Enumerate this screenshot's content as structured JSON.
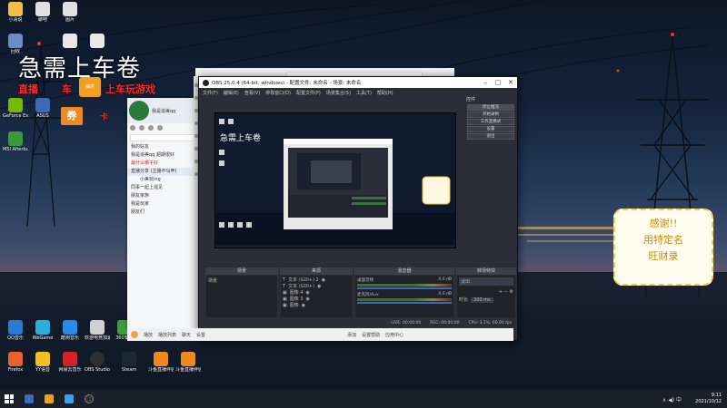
{
  "desktop": {
    "top_icons": [
      {
        "label": "小清说",
        "color": "#f0c040"
      },
      {
        "label": "聊吧",
        "color": "#e0e0e0"
      },
      {
        "label": "图片",
        "color": "#e0e0e0"
      }
    ],
    "mid_icons": [
      {
        "label": "回收",
        "color": "#6a8ac8"
      },
      {
        "label": "",
        "color": "#e8e8e8"
      },
      {
        "label": "",
        "color": "#e8e8e8"
      }
    ],
    "left_icons": [
      {
        "label": "GeForce Experience",
        "color": "#76b900"
      },
      {
        "label": "ASUS",
        "color": "#3a6ab8"
      },
      {
        "label": "MSI Afterburner",
        "color": "#3a9a3a"
      }
    ],
    "bottom_row1": [
      {
        "label": "QQ音乐",
        "color": "#2a7ad8"
      },
      {
        "label": "WeGame",
        "color": "#2ab0d8"
      },
      {
        "label": "酷狗音乐",
        "color": "#2a8ae8"
      },
      {
        "label": "欢游电竞加速器",
        "color": "#d0d0d0"
      },
      {
        "label": "360安全",
        "color": "#3aa03a"
      }
    ],
    "bottom_row2": [
      {
        "label": "Firefox",
        "color": "#e8602a"
      },
      {
        "label": "YY语音",
        "color": "#f0c020"
      },
      {
        "label": "网易云音乐",
        "color": "#d8202a"
      },
      {
        "label": "OBS Studio",
        "color": "#303030"
      },
      {
        "label": "Steam",
        "color": "#1b2838"
      },
      {
        "label": "斗鱼直播伴侣",
        "color": "#f08820"
      },
      {
        "label": "斗鱼直播伴侣",
        "color": "#f08820"
      }
    ]
  },
  "overlays": {
    "title": "急需上车卷",
    "red_left": "直播",
    "red_mid": "车",
    "badge": "抽奖",
    "red_right": "上车玩游戏",
    "coupon": "券",
    "coupon_tail": "卡"
  },
  "qq": {
    "name": "我是追美qq",
    "items": [
      {
        "label": "我的好友",
        "style": ""
      },
      {
        "label": "我是追美qq 超期很好",
        "style": ""
      },
      {
        "label": "最什么哪子好",
        "style": "red"
      },
      {
        "label": "直播分享 (主播不马甲)",
        "style": "sel"
      },
      {
        "label": "小美玩ing",
        "style": ""
      },
      {
        "label": "同事一起上混见",
        "style": ""
      },
      {
        "label": "朋友家族",
        "style": ""
      },
      {
        "label": "我是玩家",
        "style": ""
      },
      {
        "label": "朋友们",
        "style": ""
      }
    ]
  },
  "obs": {
    "title": "OBS 25.0.4 (64-bit, windows) - 配置文件: 未命名 - 场景: 未命名",
    "menu": [
      "文件(F)",
      "编辑(E)",
      "查看(V)",
      "停靠窗口(D)",
      "配置文件(P)",
      "场景集合(S)",
      "工具(T)",
      "帮助(H)"
    ],
    "controls_title": "控件",
    "control_buttons": [
      {
        "label": "停止推流",
        "active": true
      },
      {
        "label": "开始录制",
        "active": false
      },
      {
        "label": "工作室模式",
        "active": false
      },
      {
        "label": "设置",
        "active": false
      },
      {
        "label": "退出",
        "active": false
      }
    ],
    "scenes": {
      "header": "场景",
      "items": [
        "场景"
      ]
    },
    "sources": {
      "header": "来源",
      "items": [
        "文本 (GDI+) 2",
        "文本 (GDI+)",
        "图像 4",
        "图像 3",
        "图像"
      ]
    },
    "mixer": {
      "header": "混音器",
      "channels": [
        {
          "name": "桌面音频",
          "db": "0.0 dB"
        },
        {
          "name": "麦克风/Aux",
          "db": "0.0 dB"
        }
      ]
    },
    "transitions": {
      "header": "转场特效",
      "type": "淡出",
      "duration_label": "时长",
      "duration_value": "300 ms"
    },
    "status": [
      "LIVE: 00:00:00",
      "REC: 00:00:00",
      "CPU: 3.1%, 60.00 fps"
    ]
  },
  "qqbar": {
    "items": [
      "播放",
      "播放列表",
      "聊天",
      "设置",
      "添加",
      "设置帮助",
      "应用中心"
    ]
  },
  "sticker": {
    "line1": "感谢!!",
    "line2": "用特定名",
    "line3": "旺财录"
  },
  "taskbar": {
    "time": "9:11",
    "date": "2021/10/12",
    "ime": "中"
  }
}
